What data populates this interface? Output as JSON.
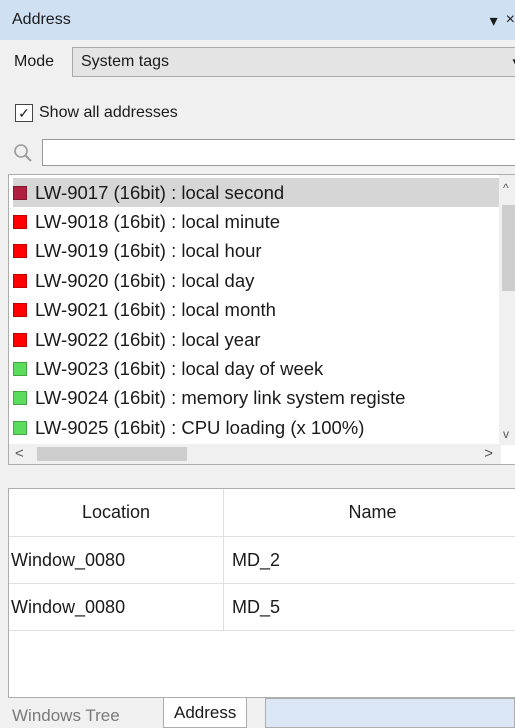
{
  "window": {
    "title": "Address",
    "dropdown_glyph": "▾",
    "close_glyph": "×"
  },
  "mode": {
    "label": "Mode",
    "value": "System tags",
    "caret": "▾"
  },
  "show_all": {
    "label": "Show all addresses",
    "checked": true,
    "check_glyph": "✓"
  },
  "search": {
    "value": "",
    "placeholder": ""
  },
  "addresses": [
    {
      "text": "LW-9017 (16bit) : local second",
      "color": "#b0203f",
      "selected": true
    },
    {
      "text": "LW-9018 (16bit) : local minute",
      "color": "#ff0000",
      "selected": false
    },
    {
      "text": "LW-9019 (16bit) : local hour",
      "color": "#ff0000",
      "selected": false
    },
    {
      "text": "LW-9020 (16bit) : local day",
      "color": "#ff0000",
      "selected": false
    },
    {
      "text": "LW-9021 (16bit) : local month",
      "color": "#ff0000",
      "selected": false
    },
    {
      "text": "LW-9022 (16bit) : local year",
      "color": "#ff0000",
      "selected": false
    },
    {
      "text": "LW-9023 (16bit) : local day of week",
      "color": "#5cdc5c",
      "selected": false
    },
    {
      "text": "LW-9024 (16bit) : memory link system registe",
      "color": "#5cdc5c",
      "selected": false
    },
    {
      "text": "LW-9025 (16bit) : CPU loading (x 100%)",
      "color": "#5cdc5c",
      "selected": false
    }
  ],
  "scroll": {
    "up": "^",
    "down": "v",
    "left": "<",
    "right": ">"
  },
  "table": {
    "headers": {
      "location": "Location",
      "name": "Name"
    },
    "rows": [
      {
        "location": "Window_0080",
        "name": "MD_2"
      },
      {
        "location": "Window_0080",
        "name": "MD_5"
      }
    ]
  },
  "tabs": [
    {
      "label": "Windows Tree",
      "active": false
    },
    {
      "label": "Address",
      "active": true
    }
  ]
}
